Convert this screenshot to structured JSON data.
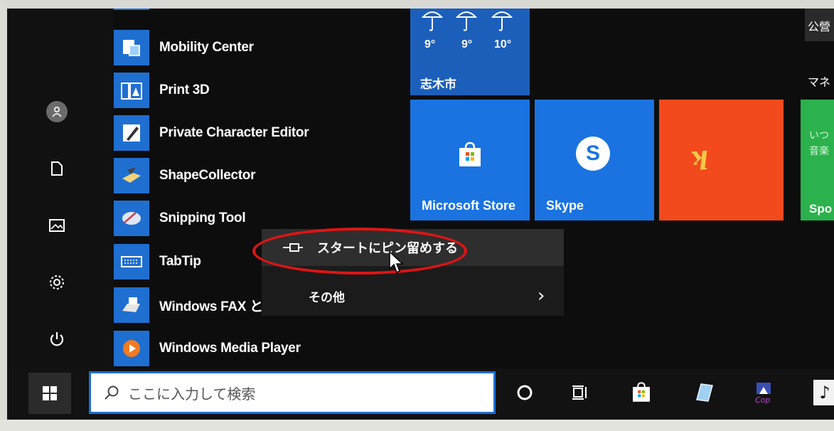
{
  "apps": [
    {
      "label": "Mobility Center",
      "icon": "mobility-center-icon"
    },
    {
      "label": "Print 3D",
      "icon": "print-3d-icon"
    },
    {
      "label": "Private Character Editor",
      "icon": "private-character-editor-icon"
    },
    {
      "label": "ShapeCollector",
      "icon": "shape-collector-icon"
    },
    {
      "label": "Snipping Tool",
      "icon": "snipping-tool-icon"
    },
    {
      "label": "TabTip",
      "icon": "keyboard-icon"
    },
    {
      "label": "Windows FAX と",
      "icon": "fax-icon"
    },
    {
      "label": "Windows Media Player",
      "icon": "media-player-icon"
    }
  ],
  "weather": {
    "temps": [
      "9°",
      "9°",
      "10°"
    ],
    "city": "志木市"
  },
  "tiles": {
    "store_label": "Microsoft Store",
    "skype_label": "Skype",
    "right_partial_1": "公營",
    "right_partial_2": "マネ",
    "green_partial_1": "いつ",
    "green_partial_2": "音楽",
    "green_partial_3": "Spo"
  },
  "context_menu": {
    "pin_label": "スタートにピン留めする",
    "more_label": "その他"
  },
  "taskbar": {
    "search_placeholder": "ここに入力して検索"
  },
  "colors": {
    "accent": "#1f6fd1",
    "king_tile": "#f24a1d",
    "green_tile": "#2bb24c",
    "highlight": "#e01414"
  }
}
